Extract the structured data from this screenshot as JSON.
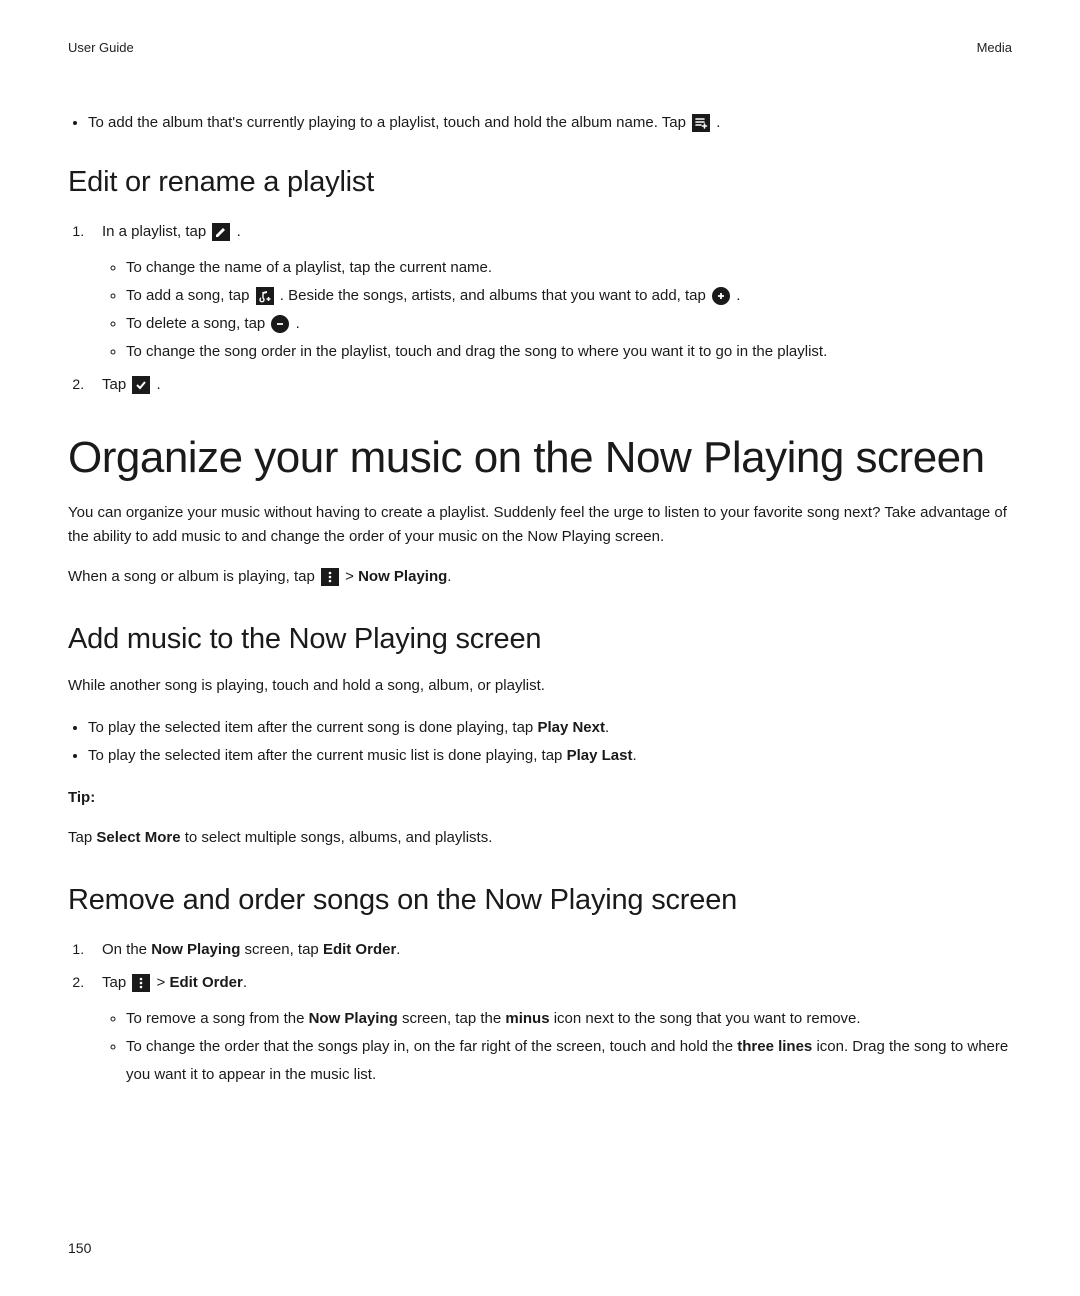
{
  "header": {
    "left": "User Guide",
    "right": "Media"
  },
  "intro_bullet": {
    "text": "To add the album that's currently playing to a playlist, touch and hold the album name. Tap ",
    "end": " ."
  },
  "sec1": {
    "heading": "Edit or rename a playlist",
    "step1_a": "In a playlist, tap ",
    "step1_b": " .",
    "sub": [
      "To change the name of a playlist, tap the current name.",
      {
        "a": "To add a song, tap ",
        "b": " . Beside the songs, artists, and albums that you want to add, tap ",
        "c": " ."
      },
      {
        "a": "To delete a song, tap ",
        "b": " ."
      },
      "To change the song order in the playlist, touch and drag the song to where you want it to go in the playlist."
    ],
    "step2_a": "Tap ",
    "step2_b": " ."
  },
  "sec2": {
    "heading": "Organize your music on the Now Playing screen",
    "p1": "You can organize your music without having to create a playlist. Suddenly feel the urge to listen to your favorite song next? Take advantage of the ability to add music to and change the order of your music on the Now Playing screen.",
    "p2_a": "When a song or album is playing, tap ",
    "p2_b": "  > ",
    "p2_bold": "Now Playing",
    "p2_c": "."
  },
  "sec3": {
    "heading": "Add music to the Now Playing screen",
    "p1": "While another song is playing, touch and hold a song, album, or playlist.",
    "b1_a": "To play the selected item after the current song is done playing, tap ",
    "b1_bold": "Play Next",
    "b1_b": ".",
    "b2_a": "To play the selected item after the current music list is done playing, tap ",
    "b2_bold": "Play Last",
    "b2_b": ".",
    "tip_label": "Tip:",
    "tip_a": "Tap ",
    "tip_bold": "Select More",
    "tip_b": " to select multiple songs, albums, and playlists."
  },
  "sec4": {
    "heading": "Remove and order songs on the Now Playing screen",
    "s1_a": "On the ",
    "s1_bold1": "Now Playing",
    "s1_b": " screen, tap ",
    "s1_bold2": "Edit Order",
    "s1_c": ".",
    "s2_a": "Tap ",
    "s2_b": "  > ",
    "s2_bold": "Edit Order",
    "s2_c": ".",
    "sub1_a": "To remove a song from the ",
    "sub1_bold1": "Now Playing",
    "sub1_b": " screen, tap the ",
    "sub1_bold2": "minus",
    "sub1_c": " icon next to the song that you want to remove.",
    "sub2_a": "To change the order that the songs play in, on the far right of the screen, touch and hold the ",
    "sub2_bold": "three lines",
    "sub2_b": " icon. Drag the song to where you want it to appear in the music list."
  },
  "page_number": "150"
}
